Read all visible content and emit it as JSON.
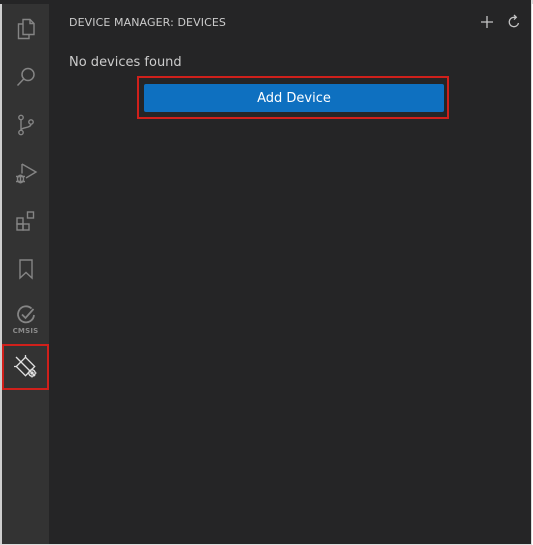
{
  "activity_bar": {
    "items": [
      {
        "name": "explorer-icon"
      },
      {
        "name": "search-icon"
      },
      {
        "name": "source-control-icon"
      },
      {
        "name": "run-debug-icon"
      },
      {
        "name": "extensions-icon"
      },
      {
        "name": "bookmark-icon"
      },
      {
        "name": "cmsis-icon",
        "label": "CMSIS"
      },
      {
        "name": "device-manager-icon"
      }
    ],
    "active": "device-manager-icon"
  },
  "sidebar": {
    "title": "DEVICE MANAGER: DEVICES",
    "actions": [
      {
        "name": "add-icon",
        "glyph": "+"
      },
      {
        "name": "refresh-icon",
        "glyph": "↻"
      }
    ],
    "message": "No devices found",
    "add_button_label": "Add Device"
  },
  "colors": {
    "activity_bar_bg": "#333333",
    "sidebar_bg": "#252526",
    "button_bg": "#0e70c0",
    "highlight": "#d0201b"
  }
}
